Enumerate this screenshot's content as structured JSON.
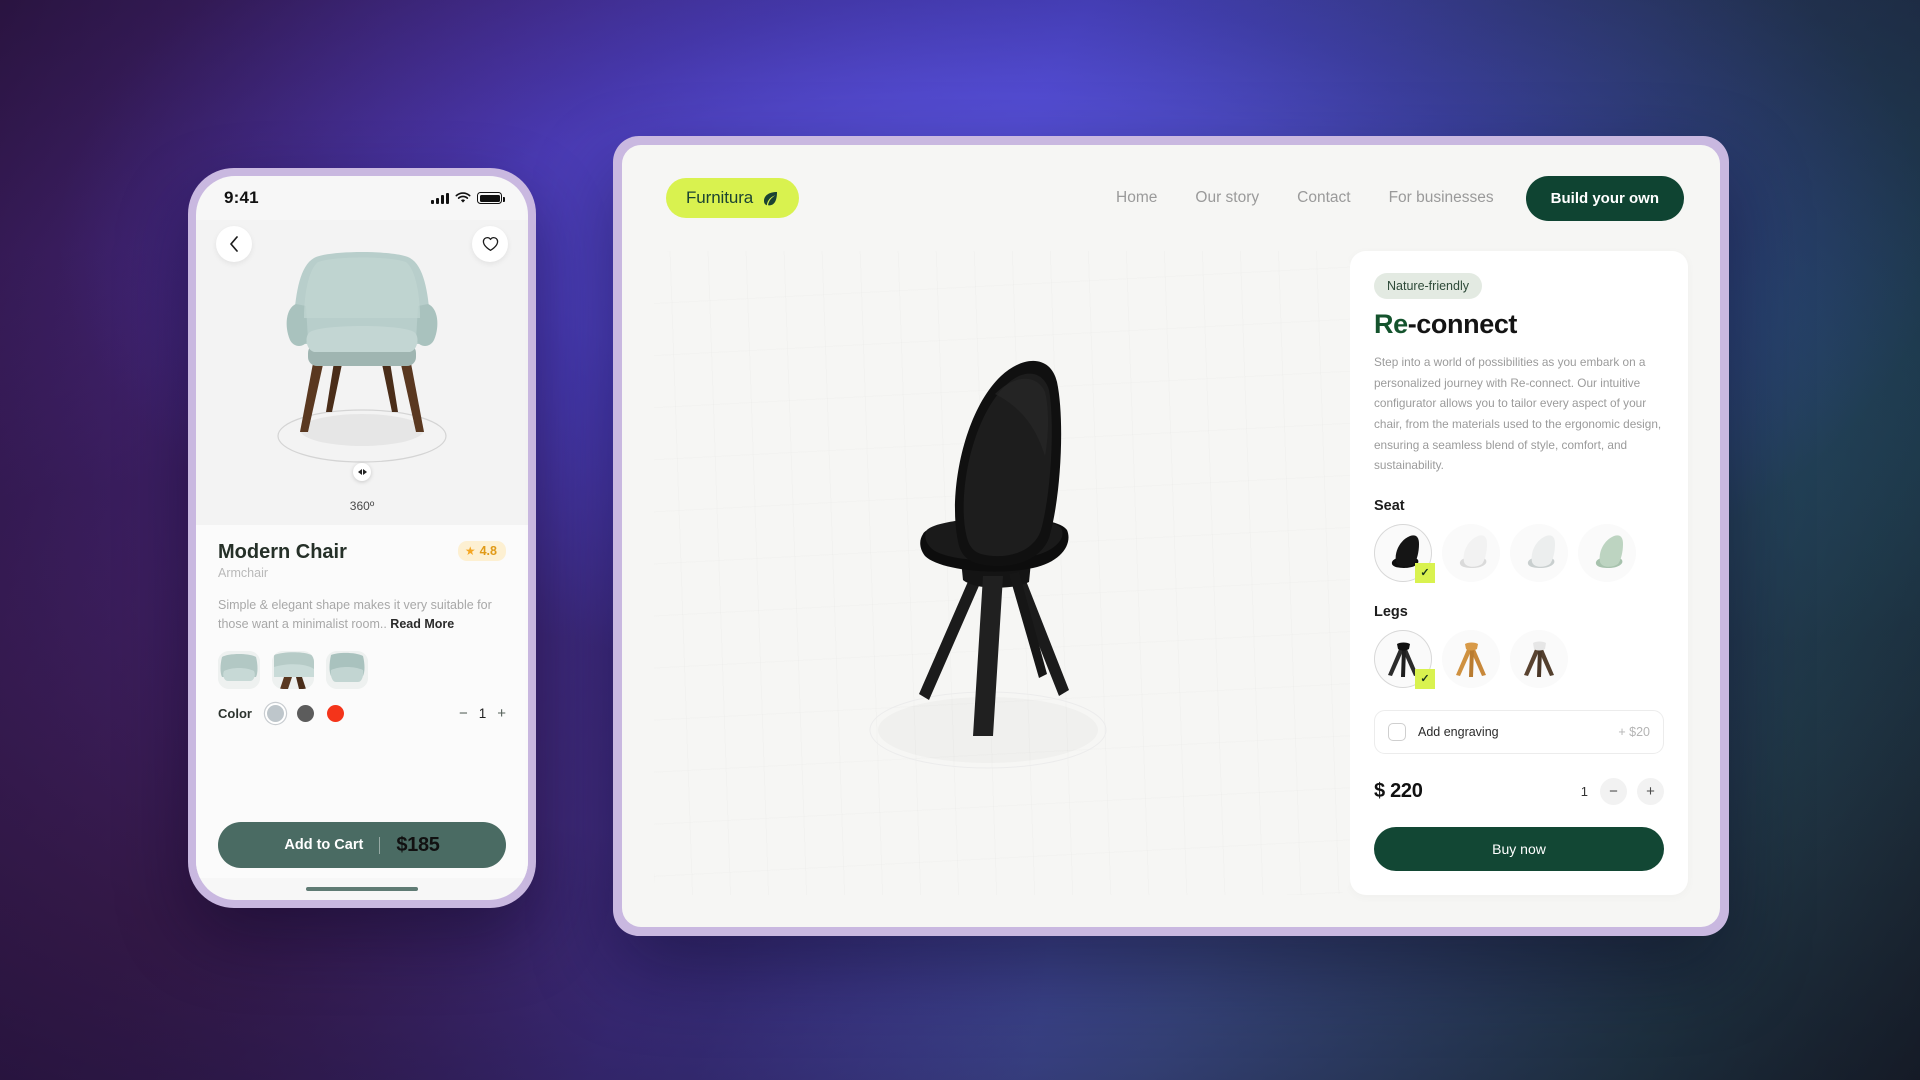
{
  "background": {
    "gradient_from": "#3a1b56",
    "gradient_mid": "#4f47c9",
    "gradient_to": "#1d2a33"
  },
  "phone": {
    "status_bar": {
      "time": "9:41",
      "signal_icon": "signal-bars-icon",
      "wifi_icon": "wifi-icon",
      "battery_icon": "battery-icon"
    },
    "back_icon": "chevron-left-icon",
    "favorite_icon": "heart-icon",
    "viewer": {
      "rotate_label": "360º",
      "knob_icon": "rotate-handle-icon"
    },
    "product": {
      "title": "Modern Chair",
      "subtitle": "Armchair",
      "rating_value": "4.8",
      "rating_icon": "star-icon",
      "description": "Simple & elegant shape makes it very suitable for those want a minimalist room..",
      "read_more": "Read More"
    },
    "thumbnails": [
      {
        "name": "thumb-front",
        "color": "#b4c6c2"
      },
      {
        "name": "thumb-side",
        "color": "#b9cac6"
      },
      {
        "name": "thumb-angle",
        "color": "#b0c3bf"
      }
    ],
    "color_picker": {
      "label": "Color",
      "swatches": [
        {
          "name": "light-gray",
          "hex": "#bec6cb",
          "selected": true
        },
        {
          "name": "dark-gray",
          "hex": "#5c5c5c",
          "selected": false
        },
        {
          "name": "red",
          "hex": "#f4341a",
          "selected": false
        }
      ]
    },
    "quantity": {
      "minus": "−",
      "value": "1",
      "plus": "+"
    },
    "cart": {
      "label": "Add to Cart",
      "price": "$185"
    }
  },
  "desktop": {
    "logo": {
      "text": "Furnitura",
      "icon": "leaf-icon",
      "bg": "#d9f24f"
    },
    "nav": [
      {
        "label": "Home"
      },
      {
        "label": "Our story"
      },
      {
        "label": "Contact"
      },
      {
        "label": "For businesses"
      }
    ],
    "cta_label": "Build your own",
    "panel": {
      "badge": "Nature-friendly",
      "title_accent": "Re",
      "title_rest": "-connect",
      "description": "Step into a world of possibilities as you embark on a personalized journey with Re-connect. Our intuitive configurator allows you to tailor every aspect of your chair, from the materials used to the ergonomic design, ensuring a seamless blend of style, comfort, and sustainability.",
      "seat": {
        "label": "Seat",
        "options": [
          {
            "name": "seat-black",
            "color": "#111111",
            "selected": true
          },
          {
            "name": "seat-white",
            "color": "#f0f0f0",
            "selected": false
          },
          {
            "name": "seat-light-gray",
            "color": "#e6e8e8",
            "selected": false
          },
          {
            "name": "seat-sage",
            "color": "#b9cfbd",
            "selected": false
          }
        ]
      },
      "legs": {
        "label": "Legs",
        "options": [
          {
            "name": "legs-black",
            "color": "#2c2c2c",
            "selected": true
          },
          {
            "name": "legs-oak",
            "color": "#cf9140",
            "selected": false
          },
          {
            "name": "legs-walnut-white",
            "color": "#5a4330",
            "selected": false
          }
        ]
      },
      "engraving": {
        "label": "Add engraving",
        "price": "+ $20",
        "checked": false
      },
      "price": "$ 220",
      "quantity": {
        "value": "1",
        "minus": "−",
        "plus": "+"
      },
      "buy_label": "Buy now"
    }
  }
}
